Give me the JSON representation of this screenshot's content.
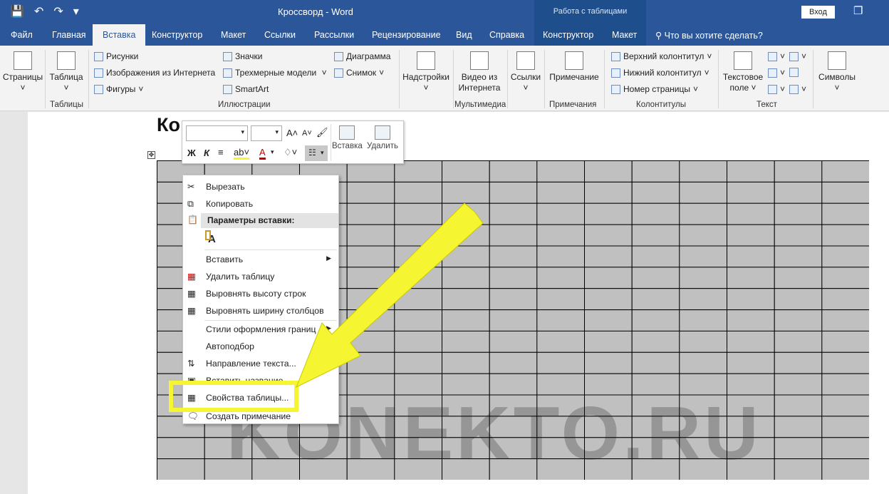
{
  "titlebar": {
    "doc_title": "Кроссворд  -  Word",
    "context_tools": "Работа с таблицами",
    "signin": "Вход"
  },
  "tabs": [
    "Файл",
    "Главная",
    "Вставка",
    "Конструктор",
    "Макет",
    "Ссылки",
    "Рассылки",
    "Рецензирование",
    "Вид",
    "Справка",
    "Конструктор",
    "Макет"
  ],
  "active_tab": "Вставка",
  "tell_me": "Что вы хотите сделать?",
  "ribbon": {
    "pages": "Страницы",
    "table": "Таблица",
    "pictures": "Рисунки",
    "online_pictures": "Изображения из Интернета",
    "shapes": "Фигуры",
    "icons": "Значки",
    "models_3d": "Трехмерные модели",
    "smartart": "SmartArt",
    "chart": "Диаграмма",
    "screenshot": "Снимок",
    "addins_1": "Надстройки",
    "video_1": "Видео из",
    "video_2": "Интернета",
    "links": "Ссылки",
    "comment": "Примечание",
    "header": "Верхний колонтитул",
    "footer": "Нижний колонтитул",
    "page_number": "Номер страницы",
    "textbox_1": "Текстовое",
    "textbox_2": "поле",
    "symbols": "Символы",
    "groups": {
      "tables": "Таблицы",
      "illustrations": "Иллюстрации",
      "multimedia": "Мультимедиа",
      "comments": "Примечания",
      "headers": "Колонтитулы",
      "text": "Текст"
    }
  },
  "document": {
    "heading": "Ко"
  },
  "mini_toolbar": {
    "bold": "Ж",
    "italic": "К",
    "insert": "Вставка",
    "delete": "Удалить"
  },
  "context_menu": {
    "cut": "Вырезать",
    "copy": "Копировать",
    "paste_options": "Параметры вставки:",
    "insert": "Вставить",
    "delete_table": "Удалить таблицу",
    "distribute_rows": "Выровнять высоту строк",
    "distribute_cols": "Выровнять ширину столбцов",
    "border_styles": "Стили оформления границ",
    "autofit": "Автоподбор",
    "text_direction": "Направление текста...",
    "insert_caption": "Вставить название...",
    "table_properties": "Свойства таблицы...",
    "new_comment": "Создать примечание"
  },
  "watermark": "KONEKTO.RU",
  "colors": {
    "word_blue": "#2b579a",
    "highlight": "#f5f532",
    "cell_fill": "#c0c0c0"
  }
}
